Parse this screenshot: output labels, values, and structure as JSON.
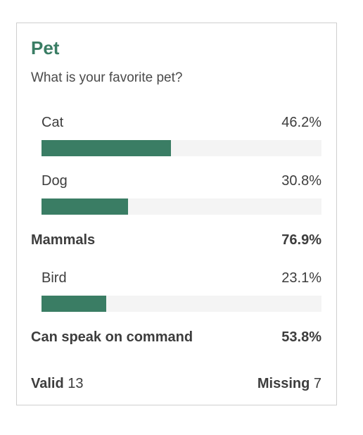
{
  "card": {
    "title": "Pet",
    "question": "What is your favorite pet?"
  },
  "options": [
    {
      "label": "Cat",
      "percent_text": "46.2%",
      "fraction": 0.462
    },
    {
      "label": "Dog",
      "percent_text": "30.8%",
      "fraction": 0.308
    },
    {
      "label": "Bird",
      "percent_text": "23.1%",
      "fraction": 0.231
    }
  ],
  "groups": [
    {
      "label": "Mammals",
      "percent_text": "76.9%"
    },
    {
      "label": "Can speak on command",
      "percent_text": "53.8%"
    }
  ],
  "footer": {
    "valid_label": "Valid",
    "valid_count": "13",
    "missing_label": "Missing",
    "missing_count": "7"
  },
  "colors": {
    "accent": "#3a7d64",
    "track": "#f4f4f4",
    "border": "#cfcfcf"
  }
}
